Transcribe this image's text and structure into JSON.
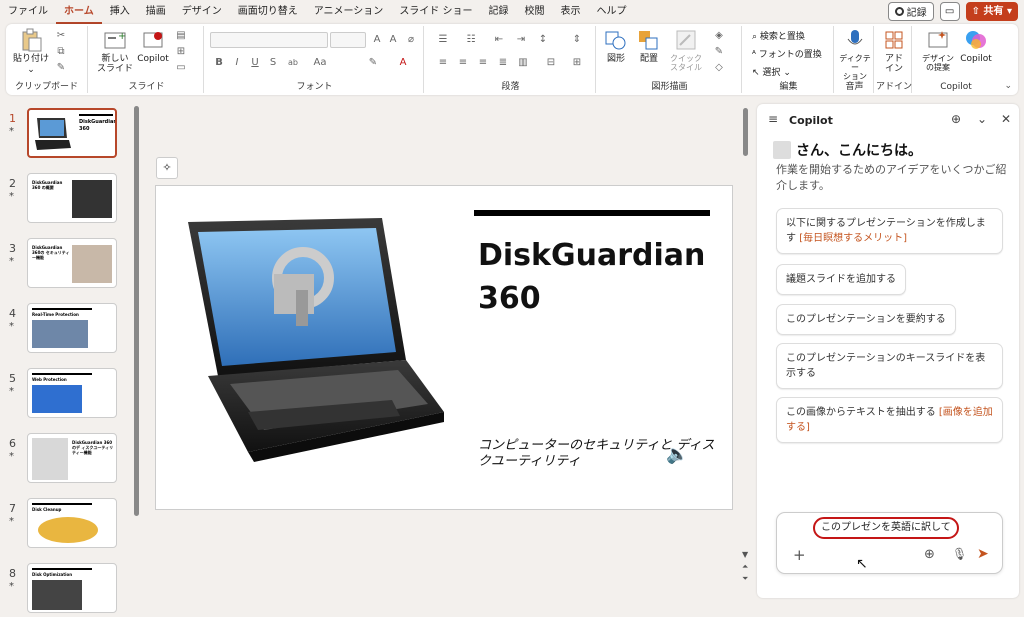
{
  "menu": {
    "tabs": [
      "ファイル",
      "ホーム",
      "挿入",
      "描画",
      "デザイン",
      "画面切り替え",
      "アニメーション",
      "スライド ショー",
      "記録",
      "校閲",
      "表示",
      "ヘルプ"
    ],
    "active_tab": "ホーム",
    "record_label": "記録",
    "share_label": "共有"
  },
  "ribbon": {
    "paste_label": "貼り付け",
    "new_slide_label": "新しい\nスライド",
    "copilot_label": "Copilot",
    "font_buttons": [
      "B",
      "I",
      "U",
      "S",
      "ab",
      "Aa"
    ],
    "shape_label": "図形",
    "arrange_label": "配置",
    "quick_style_label": "クイック\nスタイル",
    "find_replace_label": "検索と置換",
    "font_replace_label": "フォントの置換",
    "select_label": "選択",
    "dictate_label": "ディクテー\nション",
    "addin_label": "アド\nイン",
    "designer_label": "デザイン\nの提案",
    "copilot_right_label": "Copilot",
    "groups": [
      "クリップボード",
      "スライド",
      "フォント",
      "段落",
      "図形描画",
      "編集",
      "音声",
      "アドイン",
      "Copilot"
    ]
  },
  "slides": [
    {
      "num": "1",
      "title": "DiskGuardian 360",
      "selected": true
    },
    {
      "num": "2",
      "title": "DiskGuardian 360 の概要",
      "selected": false
    },
    {
      "num": "3",
      "title": "DiskGuardian 360の セキュリティー機能",
      "selected": false
    },
    {
      "num": "4",
      "title": "Real-Time Protection",
      "selected": false
    },
    {
      "num": "5",
      "title": "Web Protection",
      "selected": false
    },
    {
      "num": "6",
      "title": "DiskGuardian 360のデ ィスクユーティリティー機能",
      "selected": false
    },
    {
      "num": "7",
      "title": "Disk Cleanup",
      "selected": false
    },
    {
      "num": "8",
      "title": "Disk Optimization",
      "selected": false
    }
  ],
  "slide_main": {
    "title": "DiskGuardian 360",
    "subtitle": "コンピューターのセキュリティと ディスクユーティリティ"
  },
  "copilot": {
    "title": "Copilot",
    "greeting": "さん、こんにちは。",
    "intro": "作業を開始するためのアイデアをいくつかご紹介します。",
    "suggestions": [
      {
        "text": "以下に関するプレゼンテーションを作成します ",
        "highlight": "[毎日瞑想するメリット]"
      },
      {
        "text": "議題スライドを追加する",
        "highlight": ""
      },
      {
        "text": "このプレゼンテーションを要約する",
        "highlight": ""
      },
      {
        "text": "このプレゼンテーションのキースライドを表示する",
        "highlight": ""
      },
      {
        "text": "この画像からテキストを抽出する ",
        "highlight": "[画像を追加する]"
      }
    ],
    "input_value": "このプレゼンを英語に訳して"
  },
  "colors": {
    "accent": "#b7472a",
    "share": "#c43e1c",
    "highlight": "#c4541f",
    "input_ring": "#c41616"
  }
}
